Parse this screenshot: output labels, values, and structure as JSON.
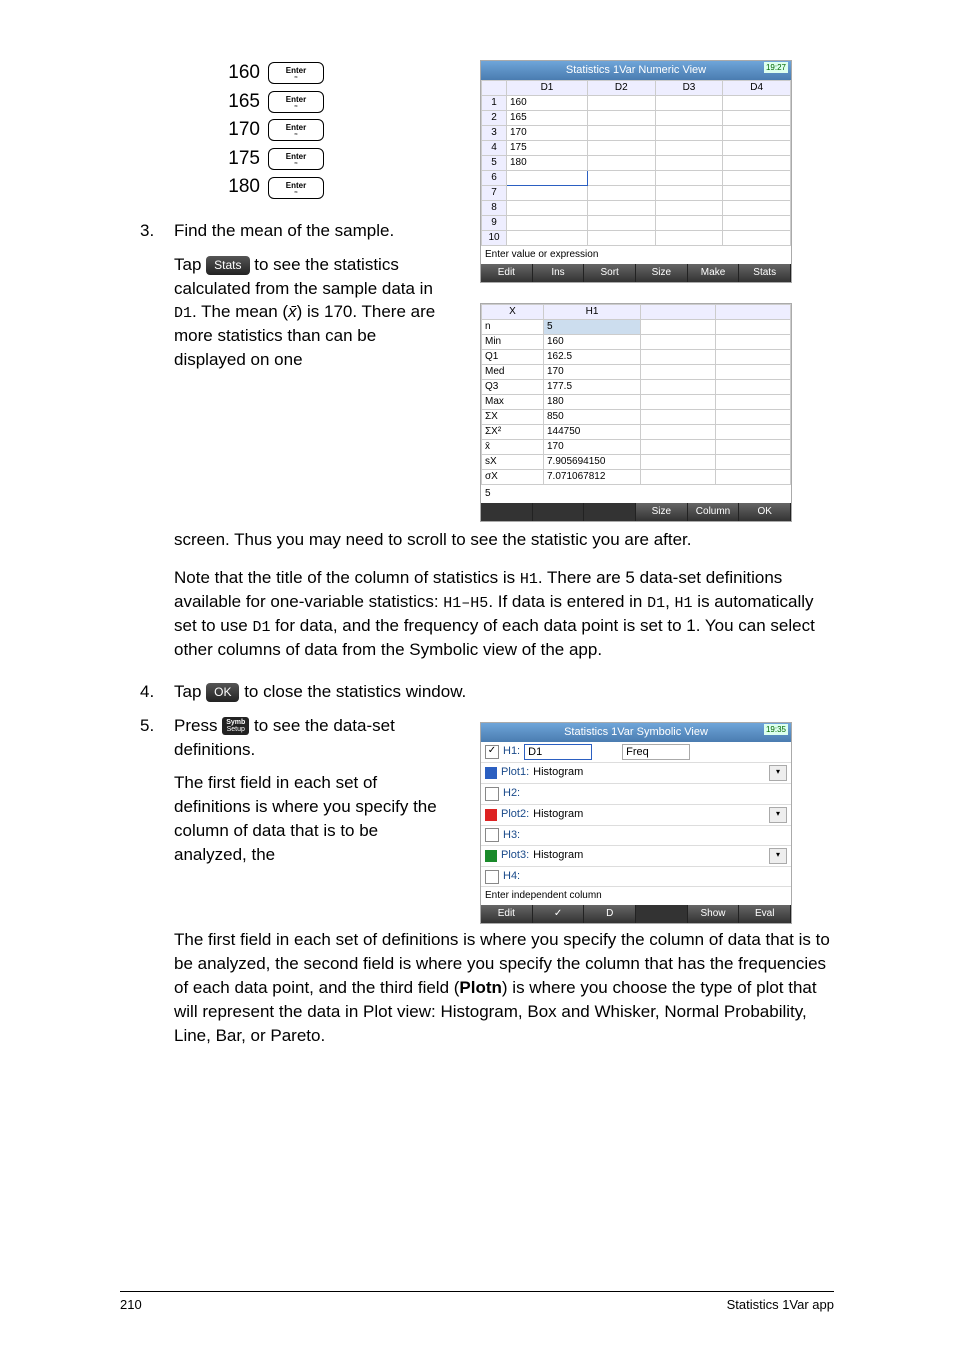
{
  "entry": {
    "values": [
      "160",
      "165",
      "170",
      "175",
      "180"
    ],
    "enter_label": "Enter",
    "enter_sub": "≈"
  },
  "step3": {
    "num": "3.",
    "text1": "Find the mean of the sample.",
    "tap": "Tap",
    "stats_btn": "Stats",
    "text2": " to see the statistics calculated from the sample data in ",
    "d1": "D1",
    "period": ".",
    "text3": " The mean (",
    "xbar": "x̄",
    "text4": ") is 170. There are more statistics than can be displayed on one screen. Thus you may need to scroll to see the statistic you are after.",
    "para2a": "Note that the title of the column of statistics is ",
    "h1": "H1",
    "para2b": ". There are 5 data-set definitions available for one-variable statistics: ",
    "range": "H1–H5",
    "para2c": ". If data is entered in ",
    "d1b": "D1",
    "para2d": ", ",
    "h1b": "H1",
    "para2e": " is automatically set to use ",
    "d1c": "D1",
    "para2f": " for data, and the frequency of each data point is set to 1. You can select other columns of data from the Symbolic view of the app."
  },
  "step4": {
    "num": "4.",
    "text1": "Tap ",
    "ok_btn": "OK",
    "text2": " to close the statistics window."
  },
  "step5": {
    "num": "5.",
    "text1": "Press ",
    "symb_top": "Symb",
    "symb_bot": "Setup",
    "text2": " to see the data-set definitions.",
    "para": "The first field in each set of definitions is where you specify the column of data that is to be analyzed, the second field is where you specify the column that has the frequencies of each data point, and the third field (",
    "plotn": "Plotn",
    "para2": ") is where you choose the type of plot that will represent the data in Plot view: Histogram, Box and Whisker, Normal Probability, Line, Bar, or Pareto."
  },
  "ss1": {
    "title": "Statistics 1Var Numeric View",
    "time": "19:27",
    "cols": [
      "D1",
      "D2",
      "D3",
      "D4"
    ],
    "rows": [
      "160",
      "165",
      "170",
      "175",
      "180"
    ],
    "help": "Enter value or expression",
    "btns": [
      "Edit",
      "Ins",
      "Sort",
      "Size",
      "Make",
      "Stats"
    ]
  },
  "ss2": {
    "xhead": "X",
    "h1head": "H1",
    "rows": [
      [
        "n",
        "5"
      ],
      [
        "Min",
        "160"
      ],
      [
        "Q1",
        "162.5"
      ],
      [
        "Med",
        "170"
      ],
      [
        "Q3",
        "177.5"
      ],
      [
        "Max",
        "180"
      ],
      [
        "ΣX",
        "850"
      ],
      [
        "ΣX²",
        "144750"
      ],
      [
        "x̄",
        "170"
      ],
      [
        "sX",
        "7.905694150"
      ],
      [
        "σX",
        "7.071067812"
      ]
    ],
    "foot": "5",
    "btns": [
      "",
      "",
      "",
      "Size",
      "Column",
      "OK"
    ]
  },
  "ss3": {
    "title": "Statistics 1Var Symbolic View",
    "time": "19:35",
    "h1": "H1:",
    "d1": "D1",
    "freq": "Freq",
    "plot1": "Plot1:",
    "plot2": "Plot2:",
    "plot3": "Plot3:",
    "hist": "Histogram",
    "h2": "H2:",
    "h3": "H3:",
    "h4": "H4:",
    "help": "Enter independent column",
    "btns": [
      "Edit",
      "✓",
      "D",
      "",
      "Show",
      "Eval"
    ]
  },
  "footer": {
    "page": "210",
    "title": "Statistics 1Var app"
  }
}
